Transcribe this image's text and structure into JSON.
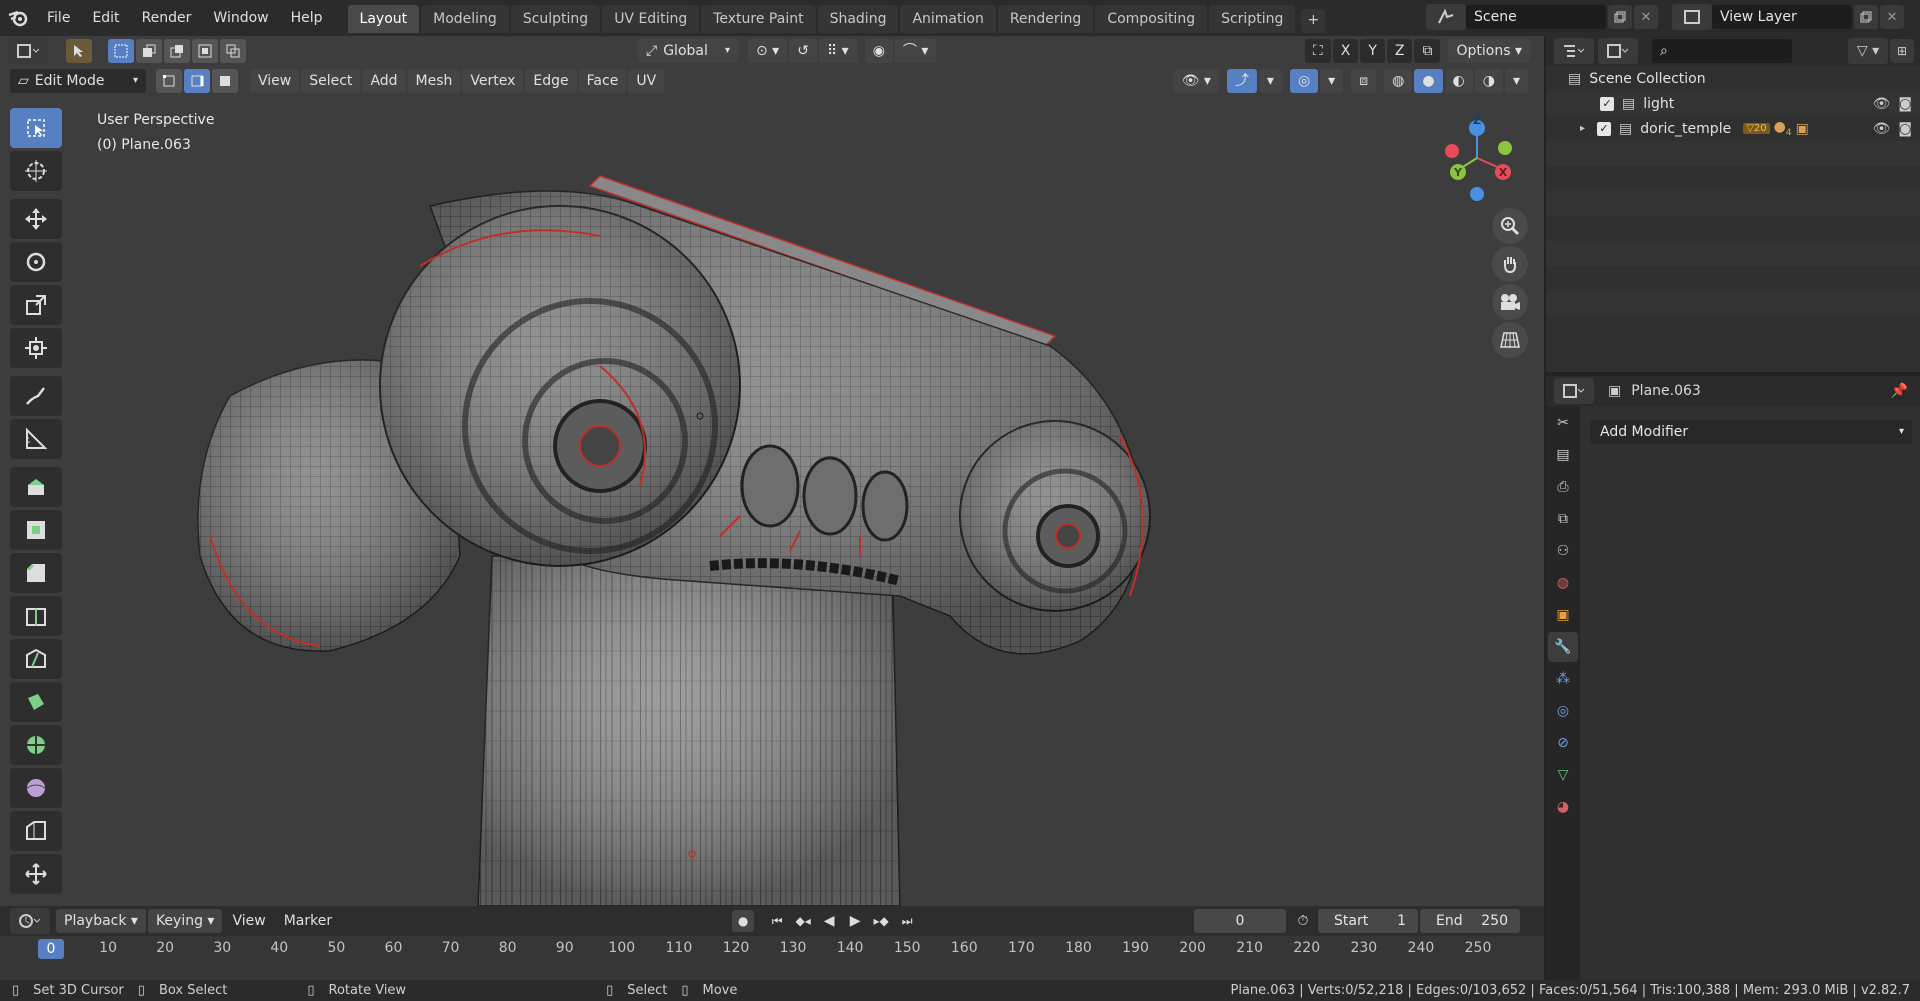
{
  "menu": [
    "File",
    "Edit",
    "Render",
    "Window",
    "Help"
  ],
  "workspaces": [
    "Layout",
    "Modeling",
    "Sculpting",
    "UV Editing",
    "Texture Paint",
    "Shading",
    "Animation",
    "Rendering",
    "Compositing",
    "Scripting"
  ],
  "workspace_add": "+",
  "scene": "Scene",
  "view_layer": "View Layer",
  "header": {
    "transform": "Global",
    "axes": [
      "X",
      "Y",
      "Z"
    ],
    "options": "Options",
    "mode": "Edit Mode",
    "menus": [
      "View",
      "Select",
      "Add",
      "Mesh",
      "Vertex",
      "Edge",
      "Face",
      "UV"
    ]
  },
  "viewport": {
    "perspective": "User Perspective",
    "object": "(0) Plane.063"
  },
  "gizmo": {
    "z": "Z",
    "y": "Y",
    "x": "X"
  },
  "outliner": {
    "root": "Scene Collection",
    "items": [
      {
        "name": "light"
      },
      {
        "name": "doric_temple"
      }
    ],
    "badge": "20",
    "badge2": "4"
  },
  "properties": {
    "object": "Plane.063",
    "add_modifier": "Add Modifier"
  },
  "timeline": {
    "menus": [
      "Playback",
      "Keying",
      "View",
      "Marker"
    ],
    "current_frame": "0",
    "start_label": "Start",
    "start": "1",
    "end_label": "End",
    "end": "250",
    "ticks": [
      "0",
      "10",
      "20",
      "30",
      "40",
      "50",
      "60",
      "70",
      "80",
      "90",
      "100",
      "110",
      "120",
      "130",
      "140",
      "150",
      "160",
      "170",
      "180",
      "190",
      "200",
      "210",
      "220",
      "230",
      "240",
      "250"
    ]
  },
  "statusbar": {
    "hint1": "Set 3D Cursor",
    "hint2": "Box Select",
    "hint3": "Rotate View",
    "hint4": "Select",
    "hint5": "Move",
    "stats": "Plane.063 | Verts:0/52,218 | Edges:0/103,652 | Faces:0/51,564 | Tris:100,388 | Mem: 293.0 MiB | v2.82.7"
  },
  "colors": {
    "accent": "#5680c2",
    "edge_red": "#c0302b",
    "x_axis": "#e84c5a",
    "y_axis": "#8bc43f",
    "z_axis": "#4a90e2"
  }
}
